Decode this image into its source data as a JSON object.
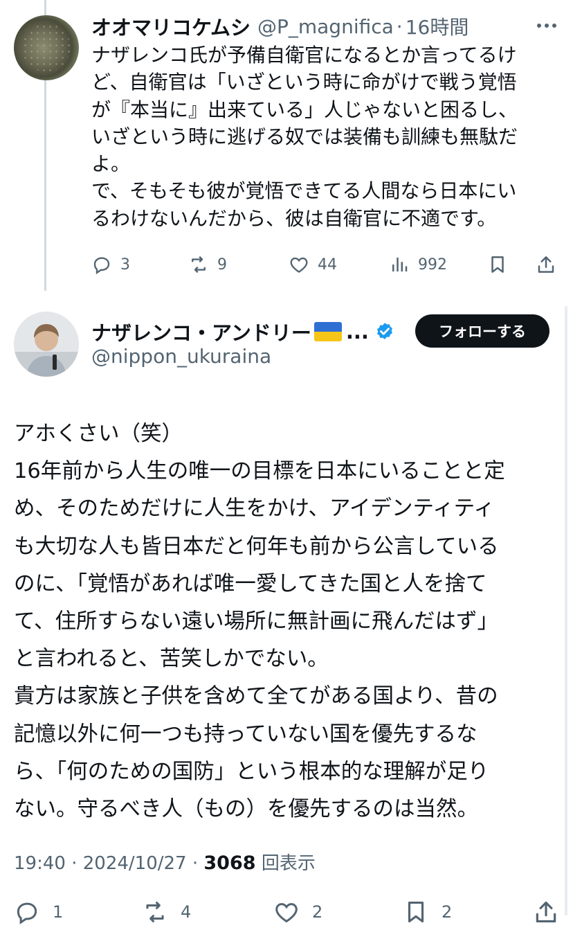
{
  "reply": {
    "name": "オオマリコケムシ",
    "handle": "@P_magnifica",
    "time": "16時間",
    "text": "ナザレンコ氏が予備自衛官になるとか言ってるけ\nど、自衛官は「いざという時に命がけで戦う覚悟\nが『本当に』出来ている」人じゃないと困るし、\nいざという時に逃げる奴では装備も訓練も無駄だ\nよ。\nで、そもそも彼が覚悟できてる人間なら日本にい\nるわけないんだから、彼は自衛官に不適です。",
    "replies": "3",
    "reposts": "9",
    "likes": "44",
    "views": "992"
  },
  "main": {
    "name": "ナザレンコ・アンドリー",
    "ellipsis": "...",
    "handle": "@nippon_ukuraina",
    "follow_label": "フォローする",
    "text": "アホくさい（笑）\n16年前から人生の唯一の目標を日本にいることと定\nめ、そのためだけに人生をかけ、アイデンティティ\nも大切な人も皆日本だと何年も前から公言している\nのに、「覚悟があれば唯一愛してきた国と人を捨て\nて、住所すらない遠い場所に無計画に飛んだはず」\nと言われると、苦笑しかでない。\n貴方は家族と子供を含めて全てがある国より、昔の\n記憶以外に何一つも持っていない国を優先するな\nら、「何のための国防」という根本的な理解が足り\nない。守るべき人（もの）を優先するのは当然。",
    "time": "19:40",
    "date": "2024/10/27",
    "views": "3068",
    "views_label": "回表示",
    "replies": "1",
    "reposts": "4",
    "likes": "2",
    "bookmarks": "2"
  },
  "colors": {
    "text": "#0f1419",
    "muted": "#536471",
    "verified": "#1d9bf0",
    "flag_blue": "#2f6fd3",
    "flag_yellow": "#f6c518"
  },
  "icons": [
    "more-icon",
    "reply-icon",
    "repost-icon",
    "like-icon",
    "views-icon",
    "bookmark-icon",
    "share-icon",
    "verified-icon",
    "ukraine-flag-icon"
  ]
}
